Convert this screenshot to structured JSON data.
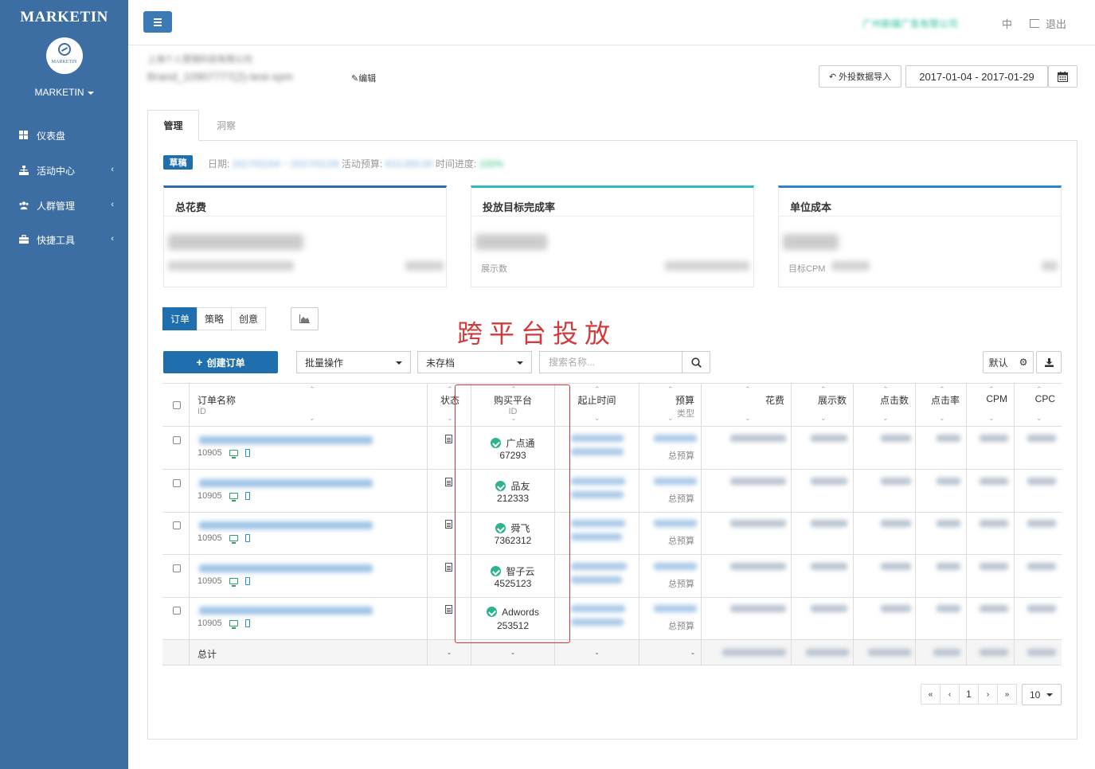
{
  "sidebar": {
    "brand": "MARKETIN",
    "logo_text": "MARKETIN",
    "user_menu": "MARKETIN",
    "items": [
      {
        "label": "仪表盘",
        "icon": "dashboard-icon"
      },
      {
        "label": "活动中心",
        "icon": "sitemap-icon"
      },
      {
        "label": "人群管理",
        "icon": "users-icon"
      },
      {
        "label": "快捷工具",
        "icon": "briefcase-icon"
      }
    ]
  },
  "header": {
    "company": "广州新媒广告有限公司",
    "lang": "中",
    "logout": "退出"
  },
  "campaign": {
    "parent": "上海个人营销科技有限公司",
    "name": "Brand_10907777(2)-test-xpm",
    "edit_label": "编辑",
    "import_label": "外投数据导入",
    "date_range": "2017-01-04 - 2017-01-29"
  },
  "tabs": [
    "管理",
    "洞察"
  ],
  "status_line": {
    "badge": "草稿",
    "date_label": "日期:",
    "date_value": "2017/01/04 ~ 2017/01/29",
    "budget_label": "活动预算:",
    "budget_value": "¥10,000.00",
    "progress_label": "时间进度:",
    "progress_value": "100%"
  },
  "kpi_cards": [
    {
      "title": "总花费",
      "sub": ""
    },
    {
      "title": "投放目标完成率",
      "sub": "展示数"
    },
    {
      "title": "单位成本",
      "sub": "目标CPM"
    }
  ],
  "view_tabs": [
    "订单",
    "策略",
    "创意"
  ],
  "overlay_title": "跨平台投放",
  "toolbar": {
    "create_label": "创建订单",
    "bulk_label": "批量操作",
    "archive_label": "未存档",
    "search_placeholder": "搜索名称...",
    "default_label": "默认"
  },
  "table": {
    "headers": {
      "name": "订单名称",
      "name_sub": "ID",
      "status": "状态",
      "platform": "购买平台",
      "platform_sub": "ID",
      "dates": "起止时间",
      "budget": "预算",
      "budget_sub": "类型",
      "spend": "花费",
      "impressions": "展示数",
      "clicks": "点击数",
      "ctr": "点击率",
      "cpm": "CPM",
      "cpc": "CPC"
    },
    "rows": [
      {
        "id": "10905",
        "platform": "广点通",
        "platform_id": "67293",
        "budget_type": "总预算"
      },
      {
        "id": "10905",
        "platform": "品友",
        "platform_id": "212333",
        "budget_type": "总预算"
      },
      {
        "id": "10905",
        "platform": "舜飞",
        "platform_id": "7362312",
        "budget_type": "总预算"
      },
      {
        "id": "10905",
        "platform": "智子云",
        "platform_id": "4525123",
        "budget_type": "总预算"
      },
      {
        "id": "10905",
        "platform": "Adwords",
        "platform_id": "253512",
        "budget_type": "总预算"
      }
    ],
    "total_label": "总计",
    "dash": "-"
  },
  "pagination": {
    "first": "«",
    "prev": "‹",
    "current": "1",
    "next": "›",
    "last": "»",
    "page_size": "10"
  },
  "colors": {
    "sidebar": "#3c6ea3",
    "primary": "#1f6faf",
    "highlight": "#d23b3b",
    "platform_icon": "#2db38f"
  }
}
